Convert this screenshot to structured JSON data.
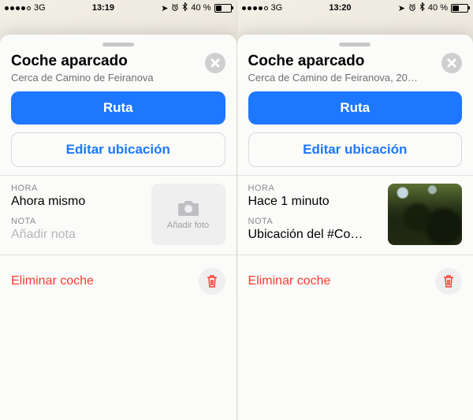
{
  "glyphs": {
    "location": "➤",
    "alarm": "⏰",
    "bluetooth": "✶"
  },
  "screens": [
    {
      "status": {
        "carrier": "3G",
        "time": "13:19",
        "battery_pct": "40 %",
        "signal_filled": 4
      },
      "title": "Coche aparcado",
      "subtitle": "Cerca de Camino de Feiranova",
      "btn_route": "Ruta",
      "btn_edit": "Editar ubicación",
      "hora_label": "HORA",
      "hora_value": "Ahora mismo",
      "nota_label": "NOTA",
      "nota_value": "Añadir nota",
      "nota_is_placeholder": true,
      "photo_caption": "Añadir foto",
      "has_photo": false,
      "delete_label": "Eliminar coche"
    },
    {
      "status": {
        "carrier": "3G",
        "time": "13:20",
        "battery_pct": "40 %",
        "signal_filled": 4
      },
      "title": "Coche aparcado",
      "subtitle": "Cerca de Camino de Feiranova, 20…",
      "btn_route": "Ruta",
      "btn_edit": "Editar ubicación",
      "hora_label": "HORA",
      "hora_value": "Hace 1 minuto",
      "nota_label": "NOTA",
      "nota_value": "Ubicación del #Co…",
      "nota_is_placeholder": false,
      "photo_caption": "",
      "has_photo": true,
      "delete_label": "Eliminar coche"
    }
  ]
}
